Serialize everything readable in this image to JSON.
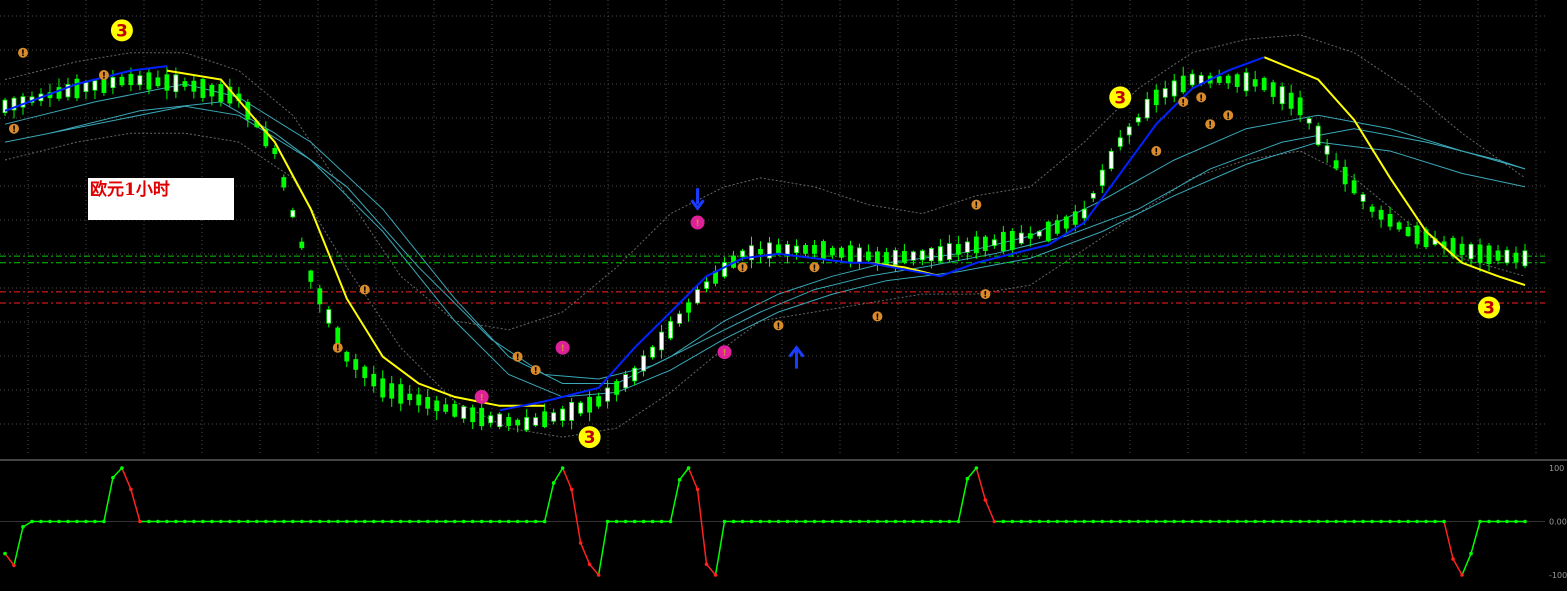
{
  "chart_data": [
    {
      "type": "candlestick",
      "panel": "main",
      "annotation_label": "欧元1小时",
      "badge_text": "3",
      "marker_text": "!",
      "ylim": [
        0,
        100
      ],
      "grid": true,
      "colors": {
        "background": "#000000",
        "grid": "#4a4a4a",
        "candle_up": "#ffffff",
        "candle_down": "#00ff00",
        "ma_yellow": "#ffff00",
        "ma_blue": "#0022ff",
        "band": "#3aa8b8",
        "envelope": "#666666",
        "level_green": "#00cc00",
        "level_red": "#ff2020",
        "badge": "#ffff00",
        "marker_orange": "#d98a2b",
        "marker_magenta": "#e0209a",
        "arrow": "#1a3cff"
      },
      "candle_count": 170,
      "x_range": [
        0,
        169
      ],
      "midline": [
        [
          0,
          78
        ],
        [
          8,
          82
        ],
        [
          14,
          84
        ],
        [
          20,
          83
        ],
        [
          26,
          80
        ],
        [
          30,
          68
        ],
        [
          34,
          40
        ],
        [
          38,
          22
        ],
        [
          42,
          15
        ],
        [
          48,
          11
        ],
        [
          54,
          8
        ],
        [
          58,
          7
        ],
        [
          62,
          9
        ],
        [
          66,
          12
        ],
        [
          70,
          18
        ],
        [
          74,
          28
        ],
        [
          78,
          38
        ],
        [
          82,
          45
        ],
        [
          86,
          46
        ],
        [
          90,
          46
        ],
        [
          94,
          45
        ],
        [
          98,
          44
        ],
        [
          104,
          45
        ],
        [
          108,
          47
        ],
        [
          112,
          48
        ],
        [
          116,
          50
        ],
        [
          120,
          54
        ],
        [
          124,
          70
        ],
        [
          128,
          80
        ],
        [
          132,
          84
        ],
        [
          136,
          84
        ],
        [
          140,
          83
        ],
        [
          144,
          78
        ],
        [
          148,
          65
        ],
        [
          152,
          55
        ],
        [
          156,
          50
        ],
        [
          160,
          47
        ],
        [
          164,
          45
        ],
        [
          169,
          44
        ]
      ],
      "ma_yellow": [
        [
          18,
          86
        ],
        [
          24,
          84
        ],
        [
          30,
          70
        ],
        [
          34,
          55
        ],
        [
          38,
          35
        ],
        [
          42,
          22
        ],
        [
          46,
          16
        ],
        [
          50,
          13
        ],
        [
          55,
          11
        ],
        [
          60,
          11
        ],
        [
          96,
          43
        ],
        [
          100,
          42
        ],
        [
          104,
          40
        ],
        [
          140,
          89
        ],
        [
          146,
          84
        ],
        [
          150,
          75
        ],
        [
          154,
          62
        ],
        [
          158,
          50
        ],
        [
          162,
          43
        ],
        [
          166,
          40
        ],
        [
          169,
          38
        ]
      ],
      "ma_blue": [
        [
          0,
          77
        ],
        [
          8,
          83
        ],
        [
          14,
          86
        ],
        [
          18,
          87
        ],
        [
          55,
          10
        ],
        [
          60,
          12
        ],
        [
          66,
          15
        ],
        [
          70,
          24
        ],
        [
          74,
          32
        ],
        [
          78,
          40
        ],
        [
          82,
          44
        ],
        [
          86,
          45
        ],
        [
          90,
          44
        ],
        [
          94,
          43
        ],
        [
          96,
          43
        ],
        [
          104,
          40
        ],
        [
          108,
          43
        ],
        [
          112,
          45
        ],
        [
          116,
          47
        ],
        [
          120,
          52
        ],
        [
          124,
          63
        ],
        [
          128,
          74
        ],
        [
          132,
          82
        ],
        [
          136,
          86
        ],
        [
          140,
          89
        ]
      ],
      "bands": [
        [
          [
            0,
            74
          ],
          [
            10,
            79
          ],
          [
            20,
            83
          ],
          [
            26,
            80
          ],
          [
            34,
            70
          ],
          [
            42,
            55
          ],
          [
            50,
            35
          ],
          [
            56,
            22
          ],
          [
            62,
            16
          ],
          [
            68,
            16
          ],
          [
            74,
            22
          ],
          [
            80,
            30
          ],
          [
            86,
            36
          ],
          [
            92,
            40
          ],
          [
            98,
            43
          ],
          [
            106,
            45
          ],
          [
            114,
            49
          ],
          [
            122,
            57
          ],
          [
            130,
            66
          ],
          [
            138,
            73
          ],
          [
            146,
            76
          ],
          [
            154,
            73
          ],
          [
            162,
            68
          ],
          [
            169,
            64
          ]
        ],
        [
          [
            0,
            70
          ],
          [
            10,
            74
          ],
          [
            20,
            78
          ],
          [
            26,
            76
          ],
          [
            34,
            66
          ],
          [
            42,
            50
          ],
          [
            50,
            30
          ],
          [
            56,
            18
          ],
          [
            62,
            13
          ],
          [
            68,
            14
          ],
          [
            74,
            19
          ],
          [
            80,
            26
          ],
          [
            86,
            32
          ],
          [
            92,
            36
          ],
          [
            98,
            39
          ],
          [
            106,
            41
          ],
          [
            114,
            44
          ],
          [
            122,
            50
          ],
          [
            130,
            58
          ],
          [
            138,
            65
          ],
          [
            146,
            70
          ],
          [
            154,
            68
          ],
          [
            162,
            63
          ],
          [
            169,
            60
          ]
        ],
        [
          [
            5,
            72
          ],
          [
            15,
            77
          ],
          [
            24,
            79
          ],
          [
            30,
            72
          ],
          [
            38,
            60
          ],
          [
            46,
            42
          ],
          [
            54,
            26
          ],
          [
            60,
            18
          ],
          [
            66,
            17
          ],
          [
            72,
            20
          ],
          [
            78,
            26
          ],
          [
            84,
            32
          ],
          [
            90,
            37
          ],
          [
            96,
            40
          ],
          [
            102,
            42
          ],
          [
            110,
            45
          ],
          [
            118,
            49
          ],
          [
            126,
            55
          ],
          [
            134,
            64
          ],
          [
            142,
            70
          ],
          [
            150,
            73
          ],
          [
            158,
            70
          ],
          [
            166,
            66
          ],
          [
            169,
            64
          ]
        ]
      ],
      "envelope_upper": [
        [
          0,
          84
        ],
        [
          8,
          88
        ],
        [
          14,
          90
        ],
        [
          20,
          90
        ],
        [
          26,
          86
        ],
        [
          32,
          76
        ],
        [
          38,
          58
        ],
        [
          44,
          40
        ],
        [
          50,
          30
        ],
        [
          56,
          28
        ],
        [
          62,
          32
        ],
        [
          68,
          42
        ],
        [
          74,
          54
        ],
        [
          80,
          60
        ],
        [
          84,
          62
        ],
        [
          90,
          60
        ],
        [
          96,
          56
        ],
        [
          102,
          54
        ],
        [
          108,
          58
        ],
        [
          114,
          60
        ],
        [
          120,
          70
        ],
        [
          126,
          82
        ],
        [
          132,
          90
        ],
        [
          138,
          93
        ],
        [
          144,
          94
        ],
        [
          150,
          90
        ],
        [
          156,
          82
        ],
        [
          162,
          72
        ],
        [
          169,
          62
        ]
      ],
      "envelope_lower": [
        [
          0,
          66
        ],
        [
          8,
          70
        ],
        [
          14,
          72
        ],
        [
          20,
          72
        ],
        [
          26,
          70
        ],
        [
          32,
          62
        ],
        [
          38,
          42
        ],
        [
          44,
          24
        ],
        [
          50,
          12
        ],
        [
          56,
          6
        ],
        [
          62,
          4
        ],
        [
          68,
          6
        ],
        [
          74,
          14
        ],
        [
          80,
          24
        ],
        [
          84,
          30
        ],
        [
          90,
          32
        ],
        [
          96,
          34
        ],
        [
          102,
          36
        ],
        [
          108,
          36
        ],
        [
          114,
          38
        ],
        [
          120,
          46
        ],
        [
          126,
          54
        ],
        [
          132,
          62
        ],
        [
          138,
          66
        ],
        [
          144,
          68
        ],
        [
          150,
          62
        ],
        [
          156,
          52
        ],
        [
          162,
          44
        ],
        [
          169,
          40
        ]
      ],
      "levels": [
        {
          "y": 44.5,
          "color": "#00cc00"
        },
        {
          "y": 43,
          "color": "#00cc00"
        },
        {
          "y": 36.5,
          "color": "#ff2020"
        },
        {
          "y": 34,
          "color": "#ff2020"
        }
      ],
      "badges": [
        {
          "x": 13,
          "y": 95
        },
        {
          "x": 65,
          "y": 4
        },
        {
          "x": 124,
          "y": 80
        },
        {
          "x": 165,
          "y": 33
        }
      ],
      "markers_orange": [
        [
          2,
          90
        ],
        [
          1,
          73
        ],
        [
          11,
          85
        ],
        [
          37,
          24
        ],
        [
          40,
          37
        ],
        [
          57,
          22
        ],
        [
          59,
          19
        ],
        [
          82,
          42
        ],
        [
          86,
          29
        ],
        [
          90,
          42
        ],
        [
          97,
          31
        ],
        [
          108,
          56
        ],
        [
          109,
          36
        ],
        [
          128,
          68
        ],
        [
          131,
          79
        ],
        [
          134,
          74
        ],
        [
          136,
          76
        ],
        [
          133,
          80
        ]
      ],
      "markers_magenta": [
        [
          53,
          13
        ],
        [
          62,
          24
        ],
        [
          77,
          52
        ],
        [
          80,
          23
        ]
      ],
      "arrows": [
        {
          "x": 77,
          "y": 57,
          "dir": "down"
        },
        {
          "x": 88,
          "y": 22,
          "dir": "up"
        }
      ]
    },
    {
      "type": "line",
      "panel": "oscillator",
      "ylim": [
        -100,
        100
      ],
      "y_ticks": [
        "100",
        "0.00",
        "-100"
      ],
      "colors": {
        "rising": "#00ff00",
        "falling": "#ff2020"
      },
      "series": [
        {
          "name": "",
          "points": [
            [
              0,
              -60
            ],
            [
              1,
              -82
            ],
            [
              2,
              -10
            ],
            [
              3,
              0
            ],
            [
              11,
              0
            ],
            [
              12,
              82
            ],
            [
              13,
              100
            ],
            [
              14,
              60
            ],
            [
              15,
              0
            ],
            [
              60,
              0
            ],
            [
              61,
              72
            ],
            [
              62,
              100
            ],
            [
              63,
              60
            ],
            [
              64,
              -40
            ],
            [
              65,
              -80
            ],
            [
              66,
              -100
            ],
            [
              67,
              0
            ],
            [
              74,
              0
            ],
            [
              75,
              78
            ],
            [
              76,
              100
            ],
            [
              77,
              60
            ],
            [
              78,
              -80
            ],
            [
              79,
              -100
            ],
            [
              80,
              0
            ],
            [
              106,
              0
            ],
            [
              107,
              80
            ],
            [
              108,
              100
            ],
            [
              109,
              40
            ],
            [
              110,
              0
            ],
            [
              160,
              0
            ],
            [
              161,
              -70
            ],
            [
              162,
              -100
            ],
            [
              163,
              -60
            ],
            [
              164,
              0
            ],
            [
              165,
              0
            ]
          ]
        }
      ]
    }
  ]
}
